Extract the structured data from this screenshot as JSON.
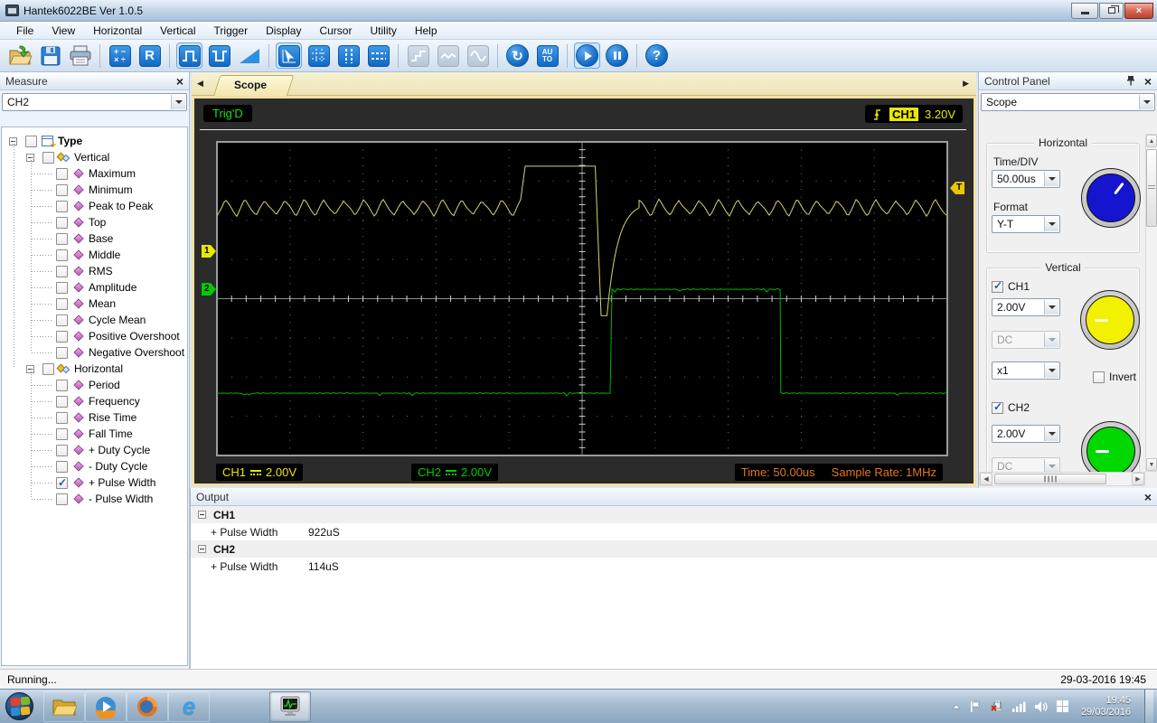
{
  "window": {
    "title": "Hantek6022BE Ver 1.0.5"
  },
  "menu": {
    "items": [
      "File",
      "View",
      "Horizontal",
      "Vertical",
      "Trigger",
      "Display",
      "Cursor",
      "Utility",
      "Help"
    ]
  },
  "toolbar": {
    "buttons": [
      {
        "name": "open",
        "variant": "raised"
      },
      {
        "name": "save",
        "variant": "raised"
      },
      {
        "name": "print",
        "variant": "raised"
      },
      "sep",
      {
        "name": "math",
        "variant": "blue"
      },
      {
        "name": "reference",
        "variant": "blue"
      },
      "sep",
      {
        "name": "positive-pulse",
        "variant": "blue",
        "selected": true
      },
      {
        "name": "negative-pulse",
        "variant": "blue"
      },
      {
        "name": "ramp",
        "variant": "plain"
      },
      "sep",
      {
        "name": "cursor-measure",
        "variant": "blue",
        "selected": true
      },
      {
        "name": "grid",
        "variant": "blue"
      },
      {
        "name": "vertical-cursors",
        "variant": "blue"
      },
      {
        "name": "horizontal-cursors",
        "variant": "blue"
      },
      "sep",
      {
        "name": "step-wave",
        "variant": "disabled"
      },
      {
        "name": "poly-wave",
        "variant": "disabled"
      },
      {
        "name": "sine-wave",
        "variant": "disabled"
      },
      "sep",
      {
        "name": "refresh",
        "variant": "round"
      },
      {
        "name": "auto-set",
        "variant": "blue"
      },
      "sep",
      {
        "name": "start",
        "variant": "round",
        "selected": true
      },
      {
        "name": "pause",
        "variant": "round"
      },
      "sep",
      {
        "name": "help",
        "variant": "round"
      }
    ]
  },
  "measure": {
    "title": "Measure",
    "channel": "CH2",
    "tree": {
      "root": "Type",
      "groups": [
        {
          "label": "Vertical",
          "items": [
            {
              "label": "Maximum",
              "checked": false
            },
            {
              "label": "Minimum",
              "checked": false
            },
            {
              "label": "Peak to Peak",
              "checked": false
            },
            {
              "label": "Top",
              "checked": false
            },
            {
              "label": "Base",
              "checked": false
            },
            {
              "label": "Middle",
              "checked": false
            },
            {
              "label": "RMS",
              "checked": false
            },
            {
              "label": "Amplitude",
              "checked": false
            },
            {
              "label": "Mean",
              "checked": false
            },
            {
              "label": "Cycle Mean",
              "checked": false
            },
            {
              "label": "Positive Overshoot",
              "checked": false
            },
            {
              "label": "Negative Overshoot",
              "checked": false
            }
          ]
        },
        {
          "label": "Horizontal",
          "items": [
            {
              "label": "Period",
              "checked": false
            },
            {
              "label": "Frequency",
              "checked": false
            },
            {
              "label": "Rise Time",
              "checked": false
            },
            {
              "label": "Fall Time",
              "checked": false
            },
            {
              "label": "+ Duty Cycle",
              "checked": false
            },
            {
              "label": "- Duty Cycle",
              "checked": false
            },
            {
              "label": "+ Pulse Width",
              "checked": true
            },
            {
              "label": "- Pulse Width",
              "checked": false
            }
          ]
        }
      ]
    }
  },
  "tabs": {
    "scope_label": "Scope"
  },
  "scope": {
    "trig_status": "Trig'D",
    "trigger": {
      "source": "CH1",
      "level": "3.20V"
    },
    "markers": {
      "ch1": "1",
      "ch2": "2",
      "trigger": "T"
    },
    "footer": {
      "ch1_label": "CH1",
      "ch1_value": "2.00V",
      "ch2_label": "CH2",
      "ch2_value": "2.00V",
      "time": "Time: 50.00us",
      "rate": "Sample Rate: 1MHz"
    }
  },
  "control": {
    "title": "Control Panel",
    "mode": "Scope",
    "horizontal": {
      "title": "Horizontal",
      "time_div_label": "Time/DIV",
      "time_div_value": "50.00us",
      "format_label": "Format",
      "format_value": "Y-T"
    },
    "vertical": {
      "title": "Vertical",
      "ch1": {
        "label": "CH1",
        "checked": true,
        "volts": "2.00V",
        "coupling": "DC",
        "probe": "x1",
        "invert_label": "Invert",
        "invert_checked": false
      },
      "ch2": {
        "label": "CH2",
        "checked": true,
        "volts": "2.00V",
        "coupling": "DC"
      }
    }
  },
  "output": {
    "title": "Output",
    "groups": [
      {
        "name": "CH1",
        "rows": [
          {
            "label": "+ Pulse Width",
            "value": "922uS"
          }
        ]
      },
      {
        "name": "CH2",
        "rows": [
          {
            "label": "+ Pulse Width",
            "value": "114uS"
          }
        ]
      }
    ]
  },
  "status": {
    "left": "Running...",
    "right": "29-03-2016 19:45"
  },
  "taskbar": {
    "buttons": [
      "start-orb",
      "explorer",
      "media-player",
      "firefox",
      "internet-explorer",
      "hantek-app"
    ],
    "active_button": "hantek-app",
    "tray": [
      "hidden-icons",
      "action-center-flag",
      "power-plug",
      "network-signal",
      "volume",
      "windows-update"
    ],
    "clock": {
      "time": "19:45",
      "date": "29/03/2016"
    }
  },
  "chart_data": {
    "type": "line",
    "title": "Oscilloscope traces",
    "x_divisions": 10,
    "y_divisions": 8,
    "time_per_div": "50.00us",
    "sample_rate": "1MHz",
    "series": [
      {
        "name": "CH1",
        "color": "#d6d662",
        "volts_per_div": "2.00V",
        "ripple": {
          "base_div": 2.32,
          "amp_div": 0.2,
          "period_div": 0.27
        },
        "segments": [
          {
            "type": "ripple",
            "x0": 0,
            "x1": 4.17
          },
          {
            "type": "level",
            "x0": 4.22,
            "x1": 5.18,
            "y_div": 3.38
          },
          {
            "type": "level",
            "x0": 5.26,
            "x1": 5.34,
            "y_div": -0.43
          },
          {
            "type": "recover",
            "x0": 5.34,
            "x1": 5.78,
            "from_div": -0.43,
            "to_div": 2.32
          },
          {
            "type": "ripple",
            "x0": 5.78,
            "x1": 10
          }
        ]
      },
      {
        "name": "CH2",
        "color": "#00b400",
        "volts_per_div": "2.00V",
        "segments": [
          {
            "type": "level",
            "x0": 0,
            "x1": 5.41,
            "y_div": -2.41,
            "noisy": true
          },
          {
            "type": "level",
            "x0": 5.41,
            "x1": 7.72,
            "y_div": 0.24,
            "noisy": true
          },
          {
            "type": "level",
            "x0": 7.72,
            "x1": 10,
            "y_div": -2.41,
            "noisy": true
          }
        ]
      }
    ],
    "markers": {
      "ch1_ref_div": 1.21,
      "ch2_ref_div": 0.24,
      "trigger_level_div": 2.82
    }
  }
}
